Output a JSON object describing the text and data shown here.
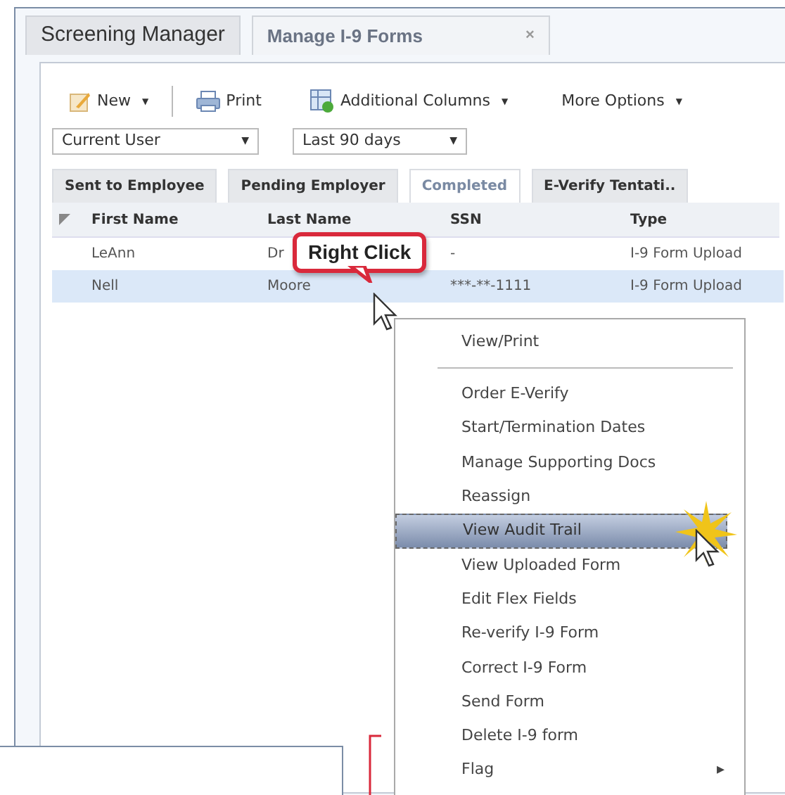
{
  "window_tabs": [
    {
      "label": "Screening Manager",
      "selected": false
    },
    {
      "label": "Manage I-9 Forms",
      "selected": true,
      "close": "×"
    }
  ],
  "toolbar": [
    {
      "kind": "new",
      "label": "New",
      "caret": "▼"
    },
    {
      "kind": "separator"
    },
    {
      "kind": "print",
      "label": "Print"
    },
    {
      "kind": "columns",
      "label": "Additional Columns",
      "caret": "▼"
    },
    {
      "kind": "plain",
      "label": "More Options",
      "caret": "▼"
    }
  ],
  "filters": [
    {
      "value": "Current User",
      "caret": "▼"
    },
    {
      "value": "Last 90 days",
      "caret": "▼"
    }
  ],
  "status_tabs": [
    {
      "label": "Sent to Employee",
      "selected": false
    },
    {
      "label": "Pending Employer",
      "selected": false
    },
    {
      "label": "Completed",
      "selected": true
    },
    {
      "label": "E-Verify Tentati..",
      "selected": false
    }
  ],
  "table": {
    "columns": [
      "First Name",
      "Last Name",
      "SSN",
      "Type"
    ],
    "rows": [
      {
        "cells": [
          "LeAnn",
          "Dr",
          "-",
          "I-9 Form Upload"
        ],
        "selected": false
      },
      {
        "cells": [
          "Nell",
          "Moore",
          "***-**-1111",
          "I-9 Form Upload"
        ],
        "selected": true
      }
    ]
  },
  "callout": {
    "text": "Right Click"
  },
  "context_menu": [
    {
      "kind": "item",
      "label": "View/Print",
      "selected": false
    },
    {
      "kind": "separator"
    },
    {
      "kind": "item",
      "label": "Order E-Verify",
      "selected": false
    },
    {
      "kind": "item",
      "label": "Start/Termination Dates",
      "selected": false
    },
    {
      "kind": "item",
      "label": "Manage Supporting Docs",
      "selected": false
    },
    {
      "kind": "item",
      "label": "Reassign",
      "selected": false
    },
    {
      "kind": "item",
      "label": "View Audit Trail",
      "selected": true
    },
    {
      "kind": "item",
      "label": "View Uploaded Form",
      "selected": false
    },
    {
      "kind": "item",
      "label": "Edit Flex Fields",
      "selected": false
    },
    {
      "kind": "item",
      "label": "Re-verify I-9 Form",
      "selected": false
    },
    {
      "kind": "item",
      "label": "Correct I-9 Form",
      "selected": false
    },
    {
      "kind": "item",
      "label": "Send Form",
      "selected": false
    },
    {
      "kind": "item",
      "label": "Delete I-9 form",
      "selected": false
    },
    {
      "kind": "submenu",
      "label": "Flag",
      "selected": false,
      "arrow": "▸"
    }
  ]
}
